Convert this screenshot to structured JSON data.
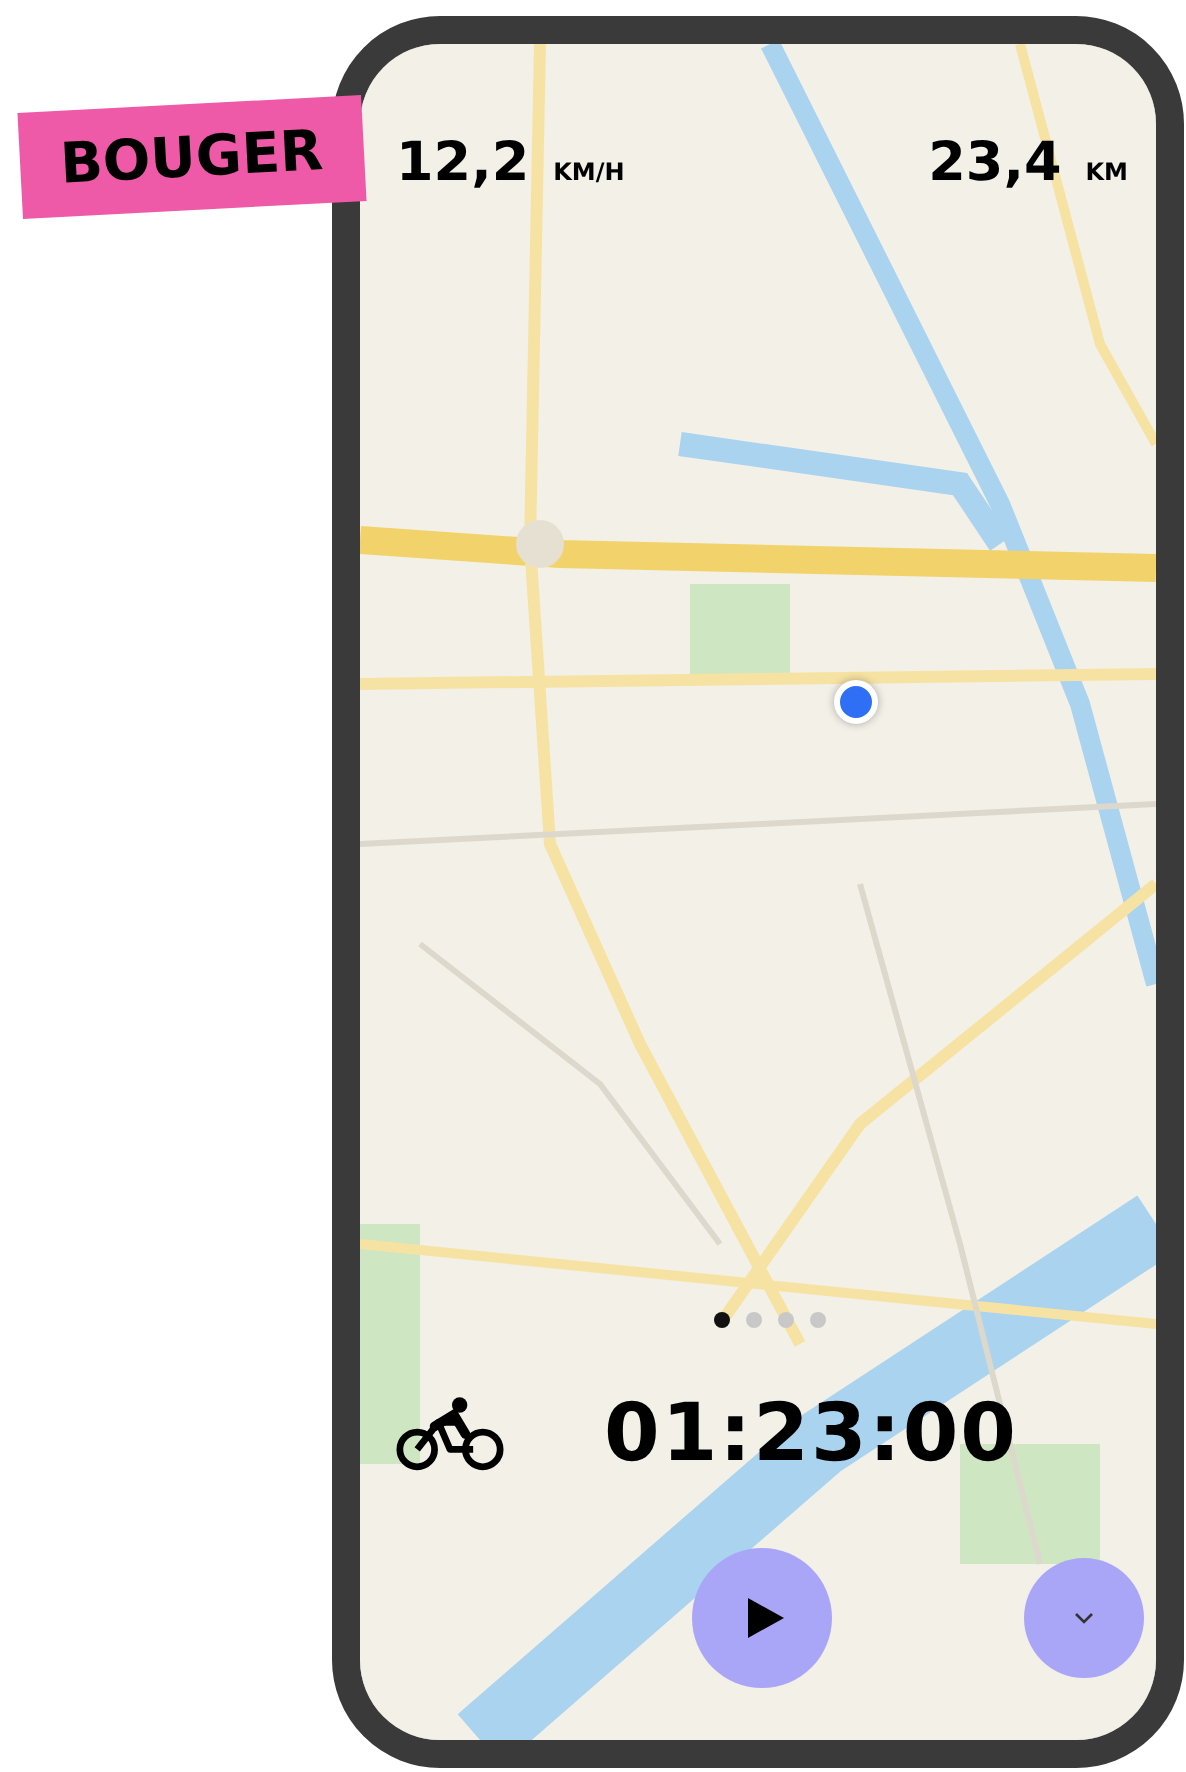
{
  "brand": "BOUGER",
  "speed": {
    "value": "12,2",
    "unit": "KM/H"
  },
  "distance": {
    "value": "23,4",
    "unit": "KM"
  },
  "page_dots": [
    {
      "selected": true
    },
    {
      "selected": false
    },
    {
      "selected": false
    },
    {
      "selected": false
    }
  ],
  "timer": "01:23:00"
}
